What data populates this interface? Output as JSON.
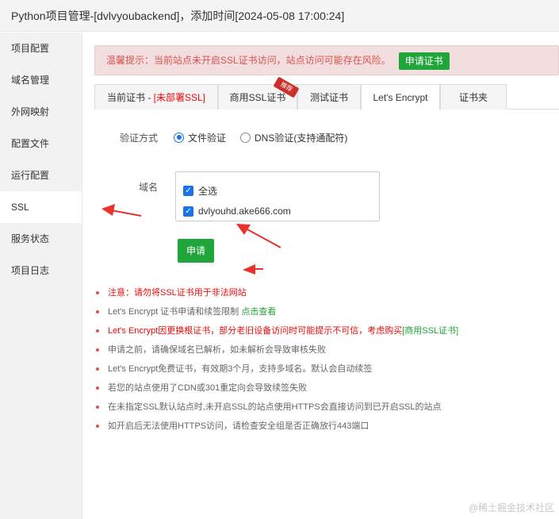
{
  "window": {
    "title": "Python项目管理-[dvlvyoubackend]，添加时间[2024-05-08 17:00:24]"
  },
  "sidebar": {
    "items": [
      {
        "label": "项目配置"
      },
      {
        "label": "域名管理"
      },
      {
        "label": "外网映射"
      },
      {
        "label": "配置文件"
      },
      {
        "label": "运行配置"
      },
      {
        "label": "SSL"
      },
      {
        "label": "服务状态"
      },
      {
        "label": "项目日志"
      }
    ],
    "active_index": 5
  },
  "warning": {
    "text": "温馨提示：当前站点未开启SSL证书访问，站点访问可能存在风险。",
    "button": "申请证书"
  },
  "tabs": {
    "current_prefix": "当前证书 - ",
    "current_status": "[未部署SSL]",
    "commercial": "商用SSL证书",
    "commercial_badge": "推荐",
    "test": "测试证书",
    "letsencrypt": "Let's Encrypt",
    "folder": "证书夹",
    "active": "Let's Encrypt"
  },
  "form": {
    "verify_label": "验证方式",
    "verify_options": [
      "文件验证",
      "DNS验证(支持通配符)"
    ],
    "verify_selected": 0,
    "domain_label": "域名",
    "select_all": "全选",
    "domains": [
      "dvlyouhd.ake666.com"
    ],
    "apply_button": "申请"
  },
  "tips": [
    {
      "text": "注意：请勿将SSL证书用于非法网站",
      "style": "red"
    },
    {
      "text": "Let's Encrypt 证书申请和续签限制 ",
      "link": "点击查看"
    },
    {
      "text": "Let's Encrypt因更换根证书，部分老旧设备访问时可能提示不可信，考虑购买",
      "link": "[商用SSL证书]",
      "style": "red"
    },
    {
      "text": "申请之前，请确保域名已解析，如未解析会导致审核失败"
    },
    {
      "text": "Let's Encrypt免费证书，有效期3个月，支持多域名。默认会自动续签"
    },
    {
      "text": "若您的站点使用了CDN或301重定向会导致续签失败"
    },
    {
      "text": "在未指定SSL默认站点时,未开启SSL的站点使用HTTPS会直接访问到已开启SSL的站点"
    },
    {
      "text": "如开启后无法使用HTTPS访问，请检查安全组是否正确放行443端口"
    }
  ],
  "watermark": "@稀土掘金技术社区",
  "colors": {
    "green": "#20a53a",
    "red": "#ef0808",
    "annotation_arrow": "#e8322a"
  }
}
